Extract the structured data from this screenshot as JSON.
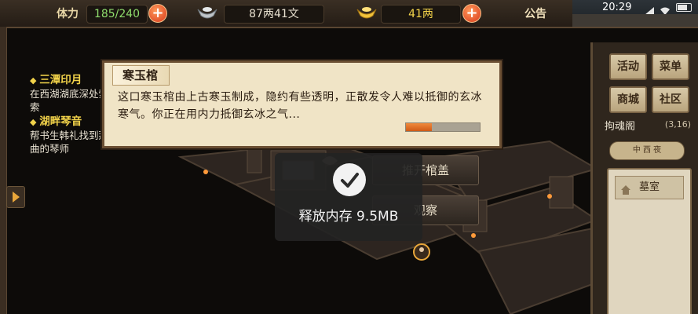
{
  "topbar": {
    "stamina_label": "体力",
    "stamina_value": "185/240",
    "silver_value": "87两41文",
    "gold_value": "41两",
    "notice_label": "公告",
    "clock": "20:29"
  },
  "quests": [
    {
      "title": "三潭印月",
      "desc": "在西湖湖底深处索一番，寻找线索"
    },
    {
      "title": "湖畔琴音",
      "desc": "帮书生韩礼找到那位在西湖上奏曲的琴师"
    }
  ],
  "dialog": {
    "title": "寒玉棺",
    "text": "这口寒玉棺由上古寒玉制成，隐约有些透明，正散发令人难以抵御的玄冰寒气。你正在用内力抵御玄冰之气...",
    "progress": 0.35
  },
  "actions": {
    "open_label": "推开棺盖",
    "observe_label": "观察"
  },
  "toast": {
    "text": "释放内存 9.5MB"
  },
  "right_panel": {
    "btn_events": "活动",
    "btn_menu": "菜单",
    "btn_shop": "商城",
    "btn_community": "社区",
    "location_name": "拘魂阁",
    "location_coords": "(3,16)",
    "compass_text": "中 西 夜",
    "room_item": "墓室"
  },
  "colors": {
    "accent_gold": "#f1d24a",
    "progress_fill": "#e27a2e",
    "toast_bg": "#232323"
  }
}
